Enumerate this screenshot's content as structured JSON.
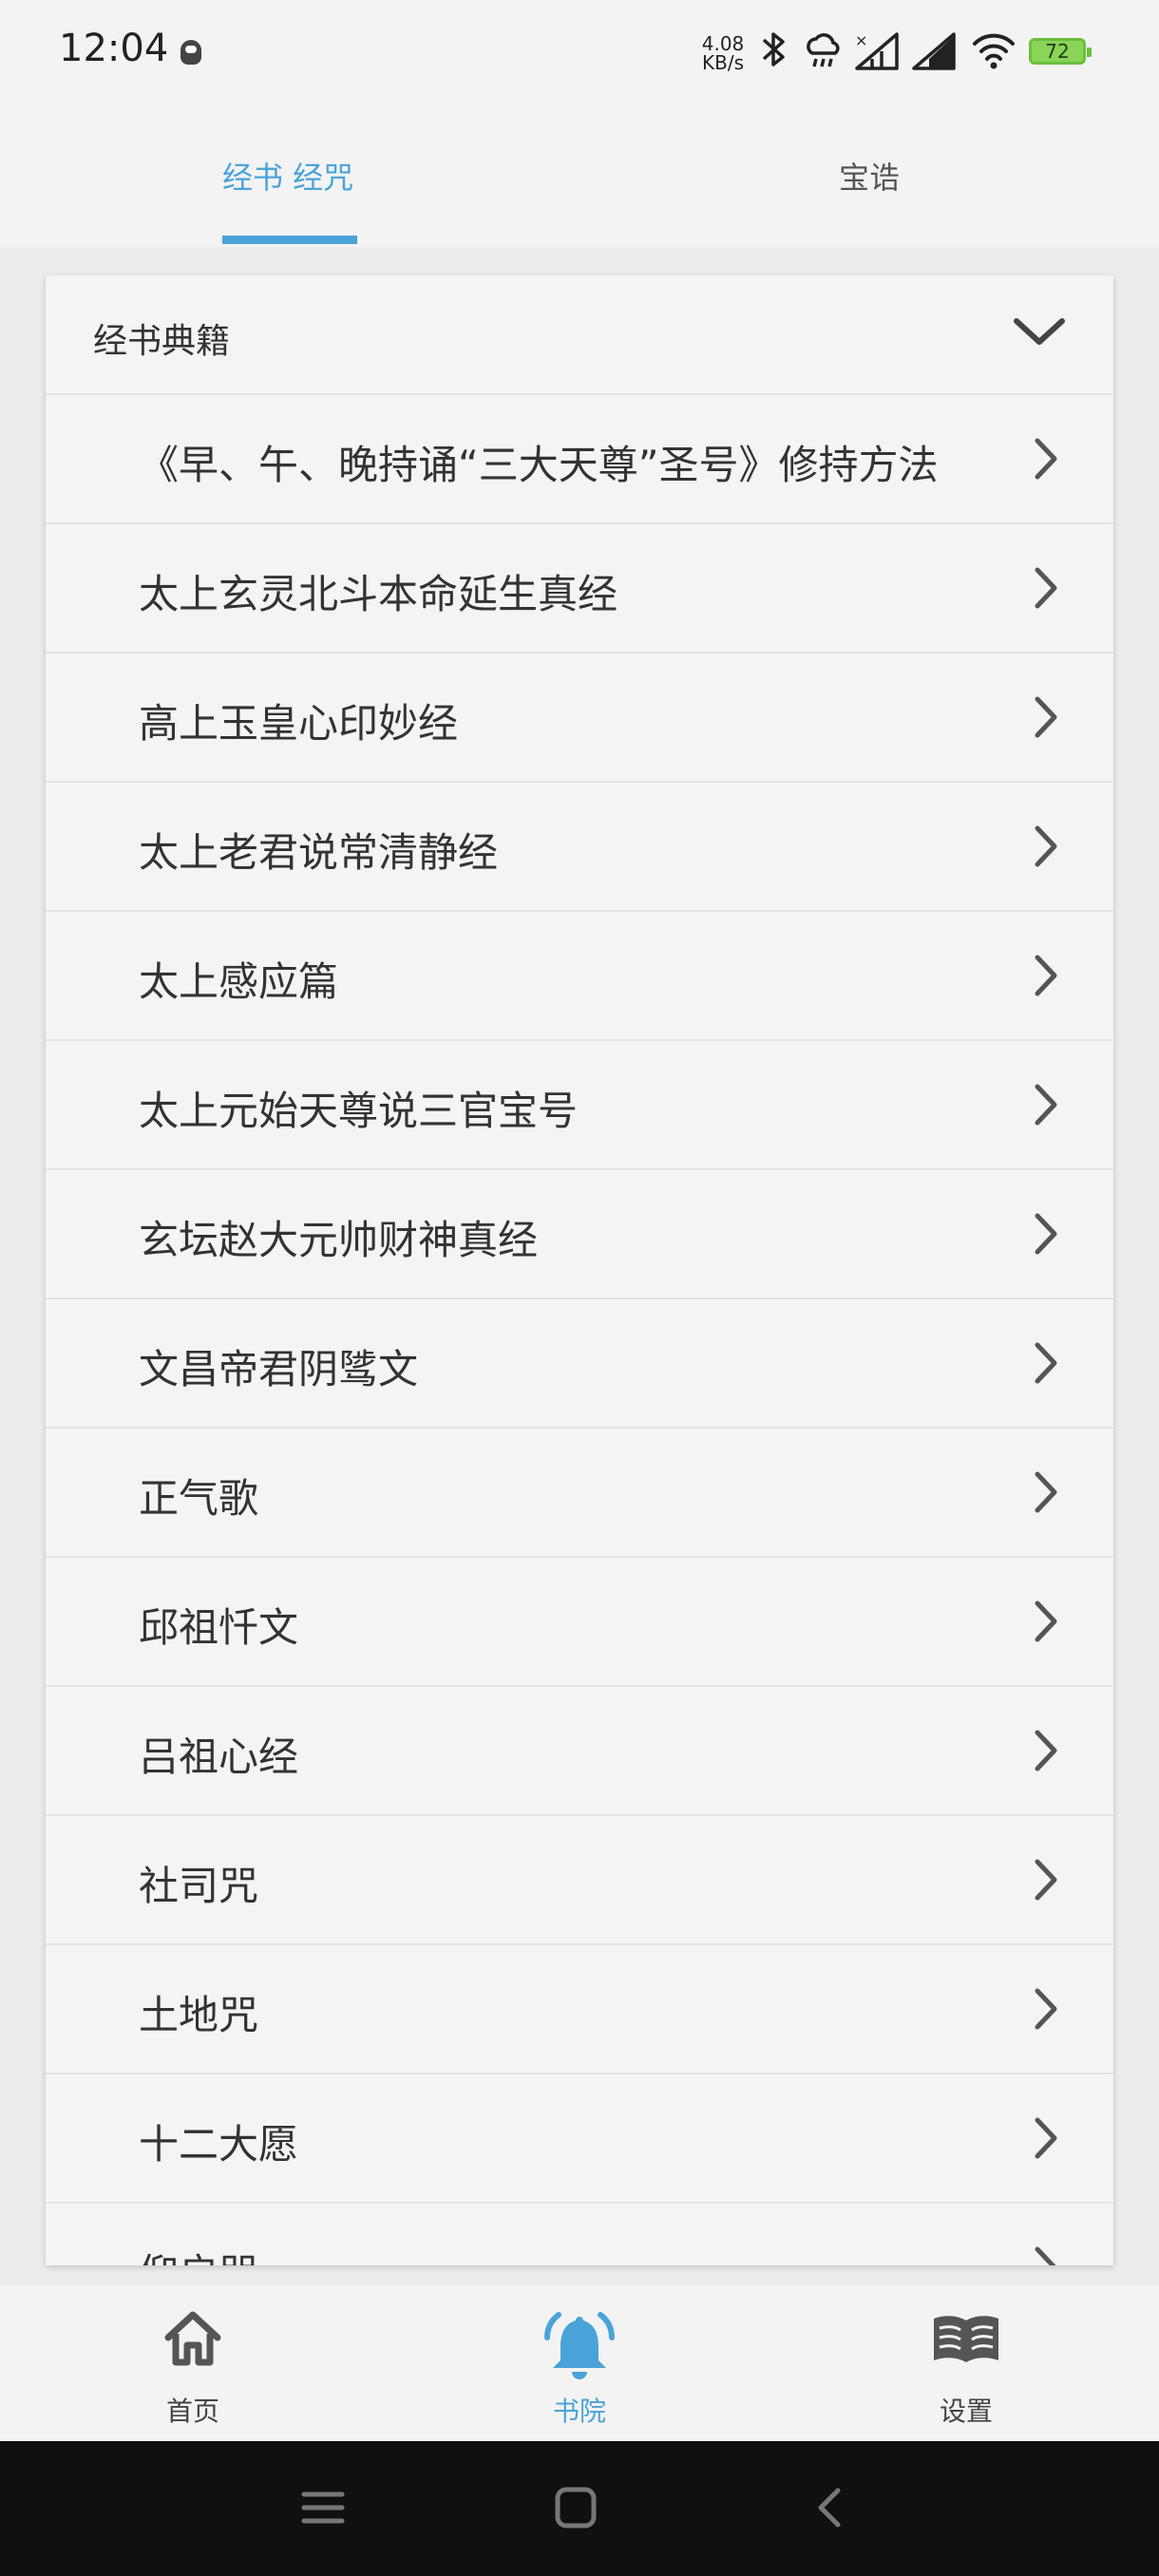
{
  "status_bar": {
    "time": "12:04",
    "net_speed_value": "4.08",
    "net_speed_unit": "KB/s",
    "battery": "72",
    "icons": [
      "qq-icon",
      "bluetooth-icon",
      "cloud-rain-icon",
      "signal-icon",
      "signal-icon",
      "wifi-icon",
      "battery-icon"
    ]
  },
  "tabs": [
    {
      "label": "经书 经咒",
      "active": true
    },
    {
      "label": "宝诰",
      "active": false
    }
  ],
  "section": {
    "title": "经书典籍",
    "items": [
      "《早、午、晚持诵“三大天尊”圣号》修持方法",
      "太上玄灵北斗本命延生真经",
      "高上玉皇心印妙经",
      "太上老君说常清静经",
      "太上感应篇",
      "太上元始天尊说三官宝号",
      "玄坛赵大元帅财神真经",
      "文昌帝君阴骘文",
      "正气歌",
      "邱祖忏文",
      "吕祖心经",
      "社司咒",
      "土地咒",
      "十二大愿",
      "仰启咒"
    ]
  },
  "bottom_nav": [
    {
      "label": "首页",
      "icon": "home-icon",
      "active": false
    },
    {
      "label": "书院",
      "icon": "bell-icon",
      "active": true
    },
    {
      "label": "设置",
      "icon": "book-icon",
      "active": false
    }
  ],
  "colors": {
    "accent": "#4aa3d8",
    "background": "#ececec",
    "card": "#f4f4f4"
  }
}
